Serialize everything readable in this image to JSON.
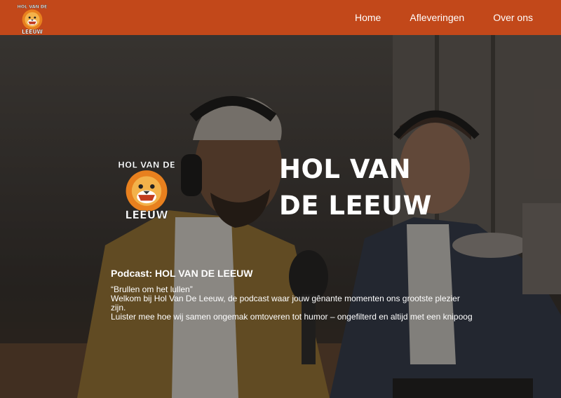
{
  "nav": {
    "logo_text_top": "HOL VAN DE",
    "logo_text_bottom": "LEEUW",
    "links": [
      "Home",
      "Afleveringen",
      "Over ons"
    ]
  },
  "hero": {
    "title": "HOL VAN DE LEEUW",
    "podcast_heading": "Podcast: HOL VAN DE LEEUW",
    "tagline": "“Brullen om het lullen”",
    "description_1": "Welkom bij Hol Van De Leeuw, de podcast waar jouw gênante momenten ons grootste plezier zijn.",
    "description_2": "Luister mee hoe wij samen ongemak omtoveren tot humor – ongefilterd en altijd met een knipoog"
  },
  "colors": {
    "nav_bg": "#c2481a",
    "accent_orange": "#e8801e"
  }
}
